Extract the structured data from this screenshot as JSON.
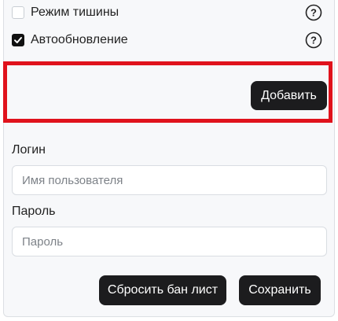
{
  "options": {
    "silent_mode": {
      "label": "Режим тишины",
      "checked": false,
      "help_icon": "question-circle"
    },
    "auto_update": {
      "label": "Автообновление",
      "checked": true,
      "help_icon": "question-circle"
    }
  },
  "highlight": {
    "add_label": "Добавить",
    "border_color": "#e0121c"
  },
  "login": {
    "label": "Логин",
    "placeholder": "Имя пользователя",
    "value": ""
  },
  "password": {
    "label": "Пароль",
    "placeholder": "Пароль",
    "value": ""
  },
  "actions": {
    "reset_ban_list_label": "Сбросить бан лист",
    "save_label": "Сохранить"
  },
  "colors": {
    "button_bg": "#1c1c1e",
    "panel_bg": "#f7f8fa",
    "highlight": "#e0121c"
  }
}
